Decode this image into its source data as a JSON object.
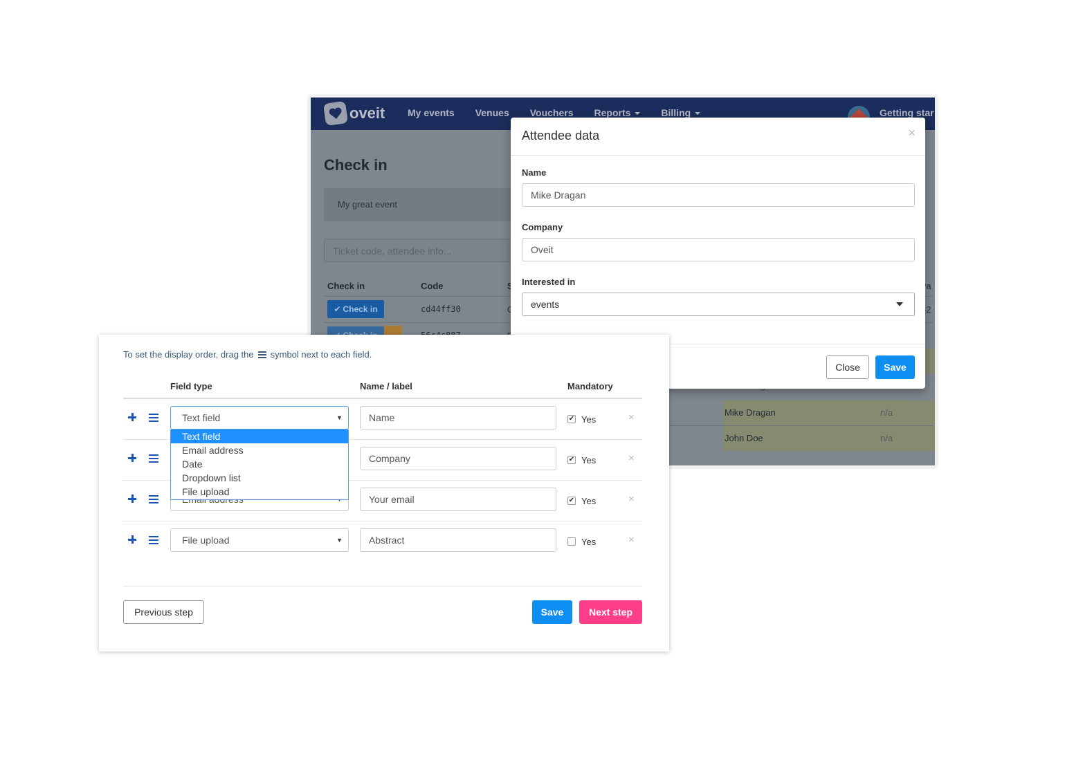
{
  "app": {
    "brand": "oveit",
    "nav": {
      "my_events": "My events",
      "venues": "Venues",
      "vouchers": "Vouchers",
      "reports": "Reports",
      "billing": "Billing",
      "getting_started": "Getting star"
    },
    "page_title": "Check in",
    "event_name": "My great event",
    "search_placeholder": "Ticket code, attendee info...",
    "table": {
      "columns": [
        "Check in",
        "Code",
        "S"
      ],
      "check_in_label": "Check in",
      "rows": [
        {
          "code": "cd44ff30"
        },
        {
          "code": "56c4c887"
        }
      ],
      "attendees": [
        {
          "name": "Mike Dragan",
          "value": "n/a"
        },
        {
          "name": "John Doe",
          "value": "n/a"
        }
      ],
      "edge_fragments": {
        "col_right": "va",
        "value_right": "82",
        "status_c": "C",
        "status_e": "E",
        "name_partial": "Mike Dragan"
      }
    }
  },
  "attendee_modal": {
    "title": "Attendee data",
    "close_symbol": "×",
    "fields": {
      "name_label": "Name",
      "name_value": "Mike Dragan",
      "company_label": "Company",
      "company_value": "Oveit",
      "interest_label": "Interested in",
      "interest_value": "events"
    },
    "close_button": "Close",
    "save_button": "Save"
  },
  "builder": {
    "hint_before": "To set the display order, drag the",
    "hint_after": "symbol next to each field.",
    "columns": {
      "field_type": "Field type",
      "name_label": "Name / label",
      "mandatory": "Mandatory"
    },
    "rows": [
      {
        "type": "Text field",
        "label": "Name",
        "mandatory": true
      },
      {
        "type": "",
        "label": "Company",
        "mandatory": true
      },
      {
        "type": "Email address",
        "label": "Your email",
        "mandatory": true
      },
      {
        "type": "File upload",
        "label": "Abstract",
        "mandatory": false
      }
    ],
    "yes_label": "Yes",
    "remove_symbol": "×",
    "dropdown_options": [
      "Text field",
      "Email address",
      "Date",
      "Dropdown list",
      "File upload"
    ],
    "dropdown_selected": "Text field",
    "previous_button": "Previous step",
    "save_button": "Save",
    "next_button": "Next step",
    "colors": {
      "primary": "#0d8ef2",
      "accent": "#ff3e8a",
      "icon": "#1a56b8",
      "navbar": "#1b2d5c"
    }
  }
}
